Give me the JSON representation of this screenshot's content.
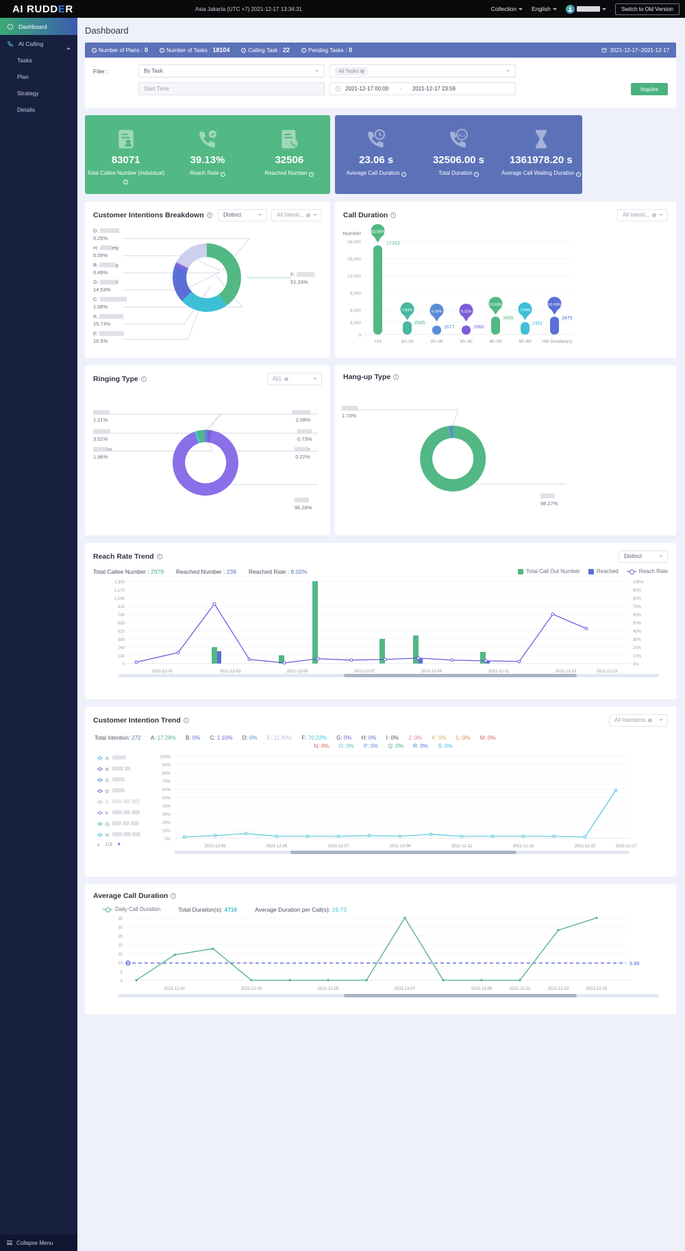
{
  "topbar": {
    "logo_pre": "AI RUDD",
    "logo_e": "E",
    "logo_post": "R",
    "timestamp": "Asia Jakarta (UTC +7) 2021-12-17 13:34:31",
    "collection": "Collection",
    "language": "English",
    "switch_version": "Switch to Old Version"
  },
  "sidebar": {
    "items": [
      {
        "label": "Dashboard",
        "icon": "dashboard-icon"
      },
      {
        "label": "AI Calling",
        "icon": "phone-icon"
      }
    ],
    "sub_items": [
      {
        "label": "Tasks"
      },
      {
        "label": "Plan"
      },
      {
        "label": "Strategy"
      },
      {
        "label": "Details"
      }
    ],
    "collapse": "Collapse Menu"
  },
  "page": {
    "title": "Dashboard"
  },
  "summary": {
    "plans_label": "Number of Plans :",
    "plans_value": "0",
    "tasks_label": "Number of Tasks :",
    "tasks_value": "18104",
    "calling_label": "Calling Task :",
    "calling_value": "22",
    "pending_label": "Pending Tasks :",
    "pending_value": "0",
    "date_range": "2021-12-17~2021-12-17"
  },
  "filter": {
    "label": "Fiter :",
    "by_task": "By Task",
    "all_tasks": "All Tasks",
    "start_time_placeholder": "Start Time",
    "date_from": "2021-12-17 00:00",
    "date_dash": "-",
    "date_to": "2021-12-17 23:59",
    "inquire": "Inquire"
  },
  "kpis": {
    "green": [
      {
        "value": "83071",
        "label": "Total Callee Number (individual)",
        "icon": "contact-card-icon"
      },
      {
        "value": "39.13%",
        "label": "Reach Rate",
        "icon": "phone-check-icon"
      },
      {
        "value": "32506",
        "label": "Reached Number",
        "icon": "call-log-icon"
      }
    ],
    "blue": [
      {
        "value": "23.06 s",
        "label": "Average Call Duration",
        "icon": "phone-clock-icon"
      },
      {
        "value": "32506.00 s",
        "label": "Total Duration",
        "icon": "phone-all-icon"
      },
      {
        "value": "1361978.20 s",
        "label": "Average Call Waiting Duration",
        "icon": "hourglass-icon"
      }
    ]
  },
  "intentions_breakdown": {
    "title": "Customer Intentions Breakdown",
    "select_distinct": "Distinct",
    "select_intent": "All Intenti...",
    "chart_data": {
      "type": "pie",
      "title": "Customer Intentions Breakdown",
      "labels": [
        "A",
        "B",
        "C",
        "D",
        "E",
        "F",
        "G",
        "H"
      ],
      "values": [
        15.73,
        0.49,
        1.08,
        0.25,
        16.5,
        51.33,
        14.53,
        0.09
      ],
      "display": [
        "15.73%",
        "0.49%",
        "1.08%",
        "0.25%",
        "16.5%",
        "51.33%",
        "14.53%",
        "0.09%"
      ],
      "colors": [
        "#5b6fd6",
        "#7c5fd8",
        "#8d7fe0",
        "#ccd0ee",
        "#3dc0d6",
        "#52b884",
        "#5b6fd6",
        "#c3c7e8"
      ]
    },
    "labels": [
      {
        "key": "D:",
        "pct": "0.25%"
      },
      {
        "key": "H:",
        "pct": "0.09%",
        "suffix": "elp"
      },
      {
        "key": "B:",
        "pct": "0.49%",
        "suffix": "g"
      },
      {
        "key": "G:",
        "pct": "14.53%",
        "suffix": "il"
      },
      {
        "key": "C:",
        "pct": "1.08%"
      },
      {
        "key": "A:",
        "pct": "15.73%"
      },
      {
        "key": "E:",
        "pct": "16.5%"
      },
      {
        "key": "F:",
        "pct": "51.33%"
      }
    ]
  },
  "call_duration": {
    "title": "Call Duration",
    "select_intent": "All Intenti...",
    "chart_data": {
      "type": "bar",
      "title": "Call Duration",
      "ylabel": "Number",
      "xlabel": "Duration(s)",
      "categories": [
        "<10",
        "10~20",
        "20~30",
        "30~40",
        "40~50",
        "50~60",
        ">60"
      ],
      "values": [
        17243,
        2545,
        1677,
        1660,
        3455,
        2451,
        3475
      ],
      "percents": [
        "53.05%",
        "7.83%",
        "5.16%",
        "5.11%",
        "10.63%",
        "7.54%",
        "10.69%"
      ],
      "colors": [
        "#52b884",
        "#4ab8a0",
        "#5b8cd6",
        "#7c5fd8",
        "#52b884",
        "#3dc0d6",
        "#5b6fd6"
      ],
      "yticks": [
        "0",
        "3,000",
        "6,000",
        "9,000",
        "12,000",
        "15,000",
        "18,000"
      ],
      "ylim": [
        0,
        18000
      ]
    }
  },
  "ringing_type": {
    "title": "Ringing Type",
    "select_all": "ALL",
    "chart_data": {
      "type": "pie",
      "title": "Ringing Type",
      "values": [
        1.21,
        3.52,
        1.96,
        2.08,
        0.73,
        0.22,
        90.28
      ],
      "display": [
        "1.21%",
        "3.52%",
        "1.96%",
        "2.08%",
        "0.73%",
        "0.22%",
        "90.28%"
      ],
      "colors": [
        "#3dc0d6",
        "#52b884",
        "#5b8cd6",
        "#7c5fd8",
        "#8d7fe0",
        "#c3c7e8",
        "#8a6fe8"
      ]
    },
    "labels": [
      {
        "pct": "1.21%"
      },
      {
        "pct": "3.52%"
      },
      {
        "pct": "1.96%",
        "suffix": "m"
      },
      {
        "pct": "2.08%"
      },
      {
        "pct": "0.73%"
      },
      {
        "pct": "0.22%"
      },
      {
        "pct": "90.28%"
      }
    ]
  },
  "hangup_type": {
    "title": "Hang-up Type",
    "chart_data": {
      "type": "pie",
      "title": "Hang-up Type",
      "values": [
        1.73,
        98.27
      ],
      "display": [
        "1.73%",
        "98.27%"
      ],
      "colors": [
        "#5b8cd6",
        "#52b884"
      ]
    },
    "labels": [
      {
        "pct": "1.73%"
      },
      {
        "pct": "98.27%"
      }
    ]
  },
  "reach_rate_trend": {
    "title": "Reach Rate Trend",
    "select_distinct": "Distinct",
    "stats": {
      "total_label": "Total Callee Number :",
      "total_value": "2979",
      "reached_label": "Reached Number :",
      "reached_value": "239",
      "rate_label": "Reached Rate :",
      "rate_value": "8.02%"
    },
    "legend": [
      {
        "label": "Total Call Out Number",
        "color": "#52b884",
        "type": "square"
      },
      {
        "label": "Reached",
        "color": "#5b6fd6",
        "type": "square"
      },
      {
        "label": "Reach Rate",
        "color": "#6a5fd8",
        "type": "line"
      }
    ],
    "chart_data": {
      "type": "bar",
      "title": "Reach Rate Trend",
      "x": [
        "2021-12-01",
        "2021-12-02",
        "2021-12-03",
        "2021-12-04",
        "2021-12-05",
        "2021-12-06",
        "2021-12-07",
        "2021-12-08",
        "2021-12-09",
        "2021-12-10",
        "2021-12-11",
        "2021-12-12",
        "2021-12-13",
        "2021-12-14",
        "2021-12-15"
      ],
      "xtick_labels": [
        "2021-12-01",
        "2021-12-03",
        "2021-12-05",
        "2021-12-07",
        "2021-12-09",
        "2021-12-11",
        "2021-12-13",
        "2021-12-15"
      ],
      "series": [
        {
          "name": "Total Call Out Number",
          "color": "#52b884",
          "values": [
            0,
            0,
            260,
            0,
            130,
            0,
            1300,
            0,
            390,
            460,
            0,
            0,
            190,
            0,
            0
          ]
        },
        {
          "name": "Reached",
          "color": "#5b6fd6",
          "values": [
            0,
            0,
            110,
            0,
            0,
            0,
            0,
            0,
            0,
            60,
            0,
            0,
            40,
            0,
            0
          ]
        },
        {
          "name": "Reach Rate",
          "color": "#6a5fd8",
          "type": "line",
          "values": [
            2,
            10,
            70,
            30,
            2,
            2,
            8,
            8,
            6,
            8,
            6,
            6,
            4,
            60,
            42
          ]
        }
      ],
      "yticks_left": [
        "0",
        "130",
        "260",
        "390",
        "520",
        "650",
        "780",
        "910",
        "1,040",
        "1,170",
        "1,300"
      ],
      "yticks_right": [
        "0%",
        "10%",
        "20%",
        "30%",
        "40%",
        "50%",
        "60%",
        "70%",
        "80%",
        "90%",
        "100%"
      ],
      "ylim_left": [
        0,
        1300
      ],
      "ylim_right": [
        0,
        100
      ]
    }
  },
  "intention_trend": {
    "title": "Customer Intention Trend",
    "select_all": "All Intentions",
    "stats_label": "Total Intention:",
    "stats_value": "272",
    "intents": [
      {
        "key": "A:",
        "val": "17.28%",
        "color": "#4cb17f"
      },
      {
        "key": "B:",
        "val": "0%",
        "color": "#5b6fd6"
      },
      {
        "key": "C:",
        "val": "1.10%",
        "color": "#6a5fd8"
      },
      {
        "key": "D:",
        "val": "0%",
        "color": "#5b8cd6"
      },
      {
        "key": "E:",
        "val": "11.40%",
        "color": "#b5c0d8"
      },
      {
        "key": "F:",
        "val": "70.22%",
        "color": "#3dc0d6"
      },
      {
        "key": "G:",
        "val": "0%",
        "color": "#7c5fd8"
      },
      {
        "key": "H:",
        "val": "0%",
        "color": "#5b6fd6"
      },
      {
        "key": "I:",
        "val": "0%",
        "color": "#4a5160"
      },
      {
        "key": "J:",
        "val": "0%",
        "color": "#d87fa0"
      },
      {
        "key": "K:",
        "val": "0%",
        "color": "#d8b35f"
      },
      {
        "key": "L:",
        "val": "0%",
        "color": "#e07f5f"
      },
      {
        "key": "M:",
        "val": "0%",
        "color": "#d85f5f"
      },
      {
        "key": "N:",
        "val": "0%",
        "color": "#e0665f"
      },
      {
        "key": "O:",
        "val": "0%",
        "color": "#5fb8c0"
      },
      {
        "key": "P:",
        "val": "0%",
        "color": "#5b8cd6"
      },
      {
        "key": "Q:",
        "val": "0%",
        "color": "#4cb17f"
      },
      {
        "key": "R:",
        "val": "0%",
        "color": "#5b6fd6"
      },
      {
        "key": "S:",
        "val": "0%",
        "color": "#3dc0d6"
      }
    ],
    "legend_rows": [
      {
        "key": "A:",
        "color": "#3dc0d6"
      },
      {
        "key": "B:",
        "color": "#5b6fd6"
      },
      {
        "key": "C:",
        "color": "#5b8cd6"
      },
      {
        "key": "D:",
        "color": "#6a5fd8"
      },
      {
        "key": "E:",
        "color": "#b5c0d8"
      },
      {
        "key": "F:",
        "color": "#8d7fe0"
      },
      {
        "key": "G:",
        "color": "#52b884"
      },
      {
        "key": "H:",
        "color": "#3dc0d6"
      }
    ],
    "pagination": "1/3",
    "chart_data": {
      "type": "line",
      "title": "Customer Intention Trend",
      "xtick_labels": [
        "2021-12-03",
        "2021-12-05",
        "2021-12-07",
        "2021-12-09",
        "2021-12-11",
        "2021-12-13",
        "2021-12-15",
        "2021-12-17"
      ],
      "yticks": [
        "0%",
        "10%",
        "20%",
        "30%",
        "40%",
        "50%",
        "60%",
        "70%",
        "80%",
        "90%",
        "100%"
      ],
      "ylim": [
        0,
        100
      ],
      "series": [
        {
          "name": "A",
          "color": "#3dc0d6",
          "values": [
            2,
            4,
            2,
            2,
            2,
            3,
            2,
            2,
            2,
            2,
            2,
            2,
            2,
            60
          ]
        },
        {
          "name": "F",
          "color": "#8d7fe0",
          "values": [
            1,
            1,
            1,
            1,
            1,
            1,
            1,
            1,
            1,
            1,
            1,
            1,
            1,
            1
          ]
        }
      ]
    }
  },
  "avg_call_duration": {
    "title": "Average Call Duration",
    "legend_label": "Daily Call Duration",
    "stats": {
      "total_label": "Total Duration(s):",
      "total_value": "4716",
      "avg_label": "Average Duration per Call(s):",
      "avg_value": "19.73"
    },
    "threshold_value": "9.85",
    "chart_data": {
      "type": "line",
      "title": "Average Call Duration",
      "xtick_labels": [
        "2021-12-01",
        "2021-12-03",
        "2021-12-05",
        "2021-12-07",
        "2021-12-09",
        "2021-12-11",
        "2021-12-13",
        "2021-12-15"
      ],
      "yticks": [
        "0",
        "5",
        "10",
        "15",
        "20",
        "25",
        "30",
        "35"
      ],
      "ylim": [
        0,
        37
      ],
      "threshold": 9.85,
      "series": [
        {
          "name": "Daily Call Duration",
          "color": "#4cb17f",
          "values": [
            0,
            14,
            18,
            0,
            0,
            0,
            0,
            35,
            0,
            0,
            0,
            26,
            35
          ]
        }
      ]
    }
  },
  "colors": {
    "green": "#52b884",
    "blue": "#5c72b8",
    "purple": "#8a6fe8",
    "cyan": "#3dc0d6",
    "sidebar": "#17203f"
  }
}
